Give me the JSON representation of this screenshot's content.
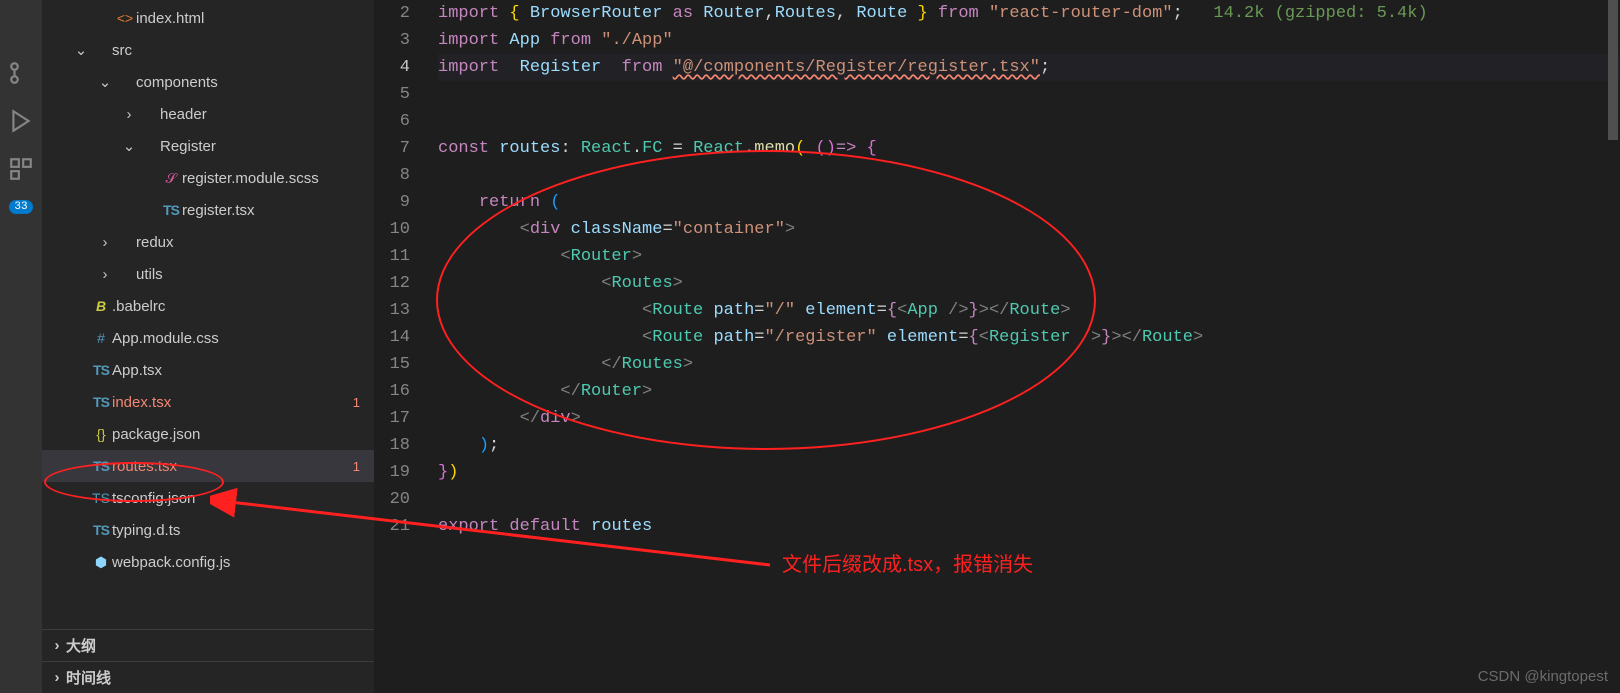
{
  "activity": {
    "badge": "33"
  },
  "tree": [
    {
      "indent": 2,
      "chev": "",
      "iconCls": "ic-html",
      "iconTxt": "<>",
      "label": "index.html",
      "err": false,
      "problems": ""
    },
    {
      "indent": 1,
      "chev": "⌄",
      "iconCls": "ic-folder",
      "iconTxt": "",
      "label": "src",
      "err": false,
      "problems": ""
    },
    {
      "indent": 2,
      "chev": "⌄",
      "iconCls": "ic-folder",
      "iconTxt": "",
      "label": "components",
      "err": false,
      "problems": ""
    },
    {
      "indent": 3,
      "chev": "›",
      "iconCls": "ic-folder",
      "iconTxt": "",
      "label": "header",
      "err": false,
      "problems": ""
    },
    {
      "indent": 3,
      "chev": "⌄",
      "iconCls": "ic-folder",
      "iconTxt": "",
      "label": "Register",
      "err": false,
      "problems": ""
    },
    {
      "indent": 4,
      "chev": "",
      "iconCls": "ic-scss",
      "iconTxt": "𝒮",
      "label": "register.module.scss",
      "err": false,
      "problems": ""
    },
    {
      "indent": 4,
      "chev": "",
      "iconCls": "ic-ts",
      "iconTxt": "TS",
      "label": "register.tsx",
      "err": false,
      "problems": ""
    },
    {
      "indent": 2,
      "chev": "›",
      "iconCls": "ic-folder",
      "iconTxt": "",
      "label": "redux",
      "err": false,
      "problems": ""
    },
    {
      "indent": 2,
      "chev": "›",
      "iconCls": "ic-folder",
      "iconTxt": "",
      "label": "utils",
      "err": false,
      "problems": ""
    },
    {
      "indent": 1,
      "chev": "",
      "iconCls": "ic-babel",
      "iconTxt": "B",
      "label": ".babelrc",
      "err": false,
      "problems": ""
    },
    {
      "indent": 1,
      "chev": "",
      "iconCls": "ic-css",
      "iconTxt": "#",
      "label": "App.module.css",
      "err": false,
      "problems": ""
    },
    {
      "indent": 1,
      "chev": "",
      "iconCls": "ic-ts",
      "iconTxt": "TS",
      "label": "App.tsx",
      "err": false,
      "problems": ""
    },
    {
      "indent": 1,
      "chev": "",
      "iconCls": "ic-ts",
      "iconTxt": "TS",
      "label": "index.tsx",
      "err": true,
      "problems": "1"
    },
    {
      "indent": 1,
      "chev": "",
      "iconCls": "ic-json",
      "iconTxt": "{}",
      "label": "package.json",
      "err": false,
      "problems": ""
    },
    {
      "indent": 1,
      "chev": "",
      "iconCls": "ic-ts",
      "iconTxt": "TS",
      "label": "routes.tsx",
      "err": true,
      "problems": "1",
      "selected": true
    },
    {
      "indent": 1,
      "chev": "",
      "iconCls": "ic-tsconfig",
      "iconTxt": "TS",
      "label": "tsconfig.json",
      "err": false,
      "problems": ""
    },
    {
      "indent": 1,
      "chev": "",
      "iconCls": "ic-ts",
      "iconTxt": "TS",
      "label": "typing.d.ts",
      "err": false,
      "problems": ""
    },
    {
      "indent": 1,
      "chev": "",
      "iconCls": "ic-webpack",
      "iconTxt": "⬢",
      "label": "webpack.config.js",
      "err": false,
      "problems": ""
    }
  ],
  "outline": [
    {
      "label": "大纲",
      "chev": "›"
    },
    {
      "label": "时间线",
      "chev": "›"
    }
  ],
  "gutter": {
    "start": 2,
    "end": 21,
    "active": 4
  },
  "hint": "14.2k (gzipped: 5.4k)",
  "code": {
    "l2": {
      "imp": "import",
      "br": "{ ",
      "BrowserRouter": "BrowserRouter",
      "as": " as ",
      "Router": "Router",
      "c": ",",
      "Routes": "Routes",
      "c2": ", ",
      "Route": "Route",
      "brc": " }",
      "from": " from ",
      "str": "\"react-router-dom\"",
      "sc": ";"
    },
    "l3": {
      "imp": "import ",
      "App": "App",
      "from": " from ",
      "str": "\"./App\""
    },
    "l4": {
      "imp": "import  ",
      "Register": "Register",
      "from": "  from ",
      "str": "\"@/components/Register/register.tsx\"",
      "sc": ";"
    },
    "l7": {
      "const": "const ",
      "routes": "routes",
      "col": ": ",
      "React": "React",
      ".": ".",
      "FC": "FC",
      "eq": " = ",
      "React2": "React",
      ".2": ".",
      "memo": "memo",
      "p": "( ",
      "arrow": "()",
      "fat": "=> ",
      "brace": "{"
    },
    "l9": {
      "return": "return ",
      "p": "("
    },
    "l10": {
      "o": "<",
      "div": "div",
      " ": " ",
      "className": "className",
      "eq": "=",
      "str": "\"container\"",
      "c": ">"
    },
    "l11": {
      "o": "<",
      "Router": "Router",
      "c": ">"
    },
    "l12": {
      "o": "<",
      "Routes": "Routes",
      "c": ">"
    },
    "l13": {
      "o": "<",
      "Route": "Route",
      " ": " ",
      "path": "path",
      "eq": "=",
      "str": "\"/\"",
      " 2": " ",
      "element": "element",
      "eq2": "=",
      "b": "{",
      "o2": "<",
      "App": "App",
      "sl": " /",
      "c2": ">",
      "b2": "}",
      "c3": ">",
      "co": "</",
      "Route2": "Route",
      "c4": ">"
    },
    "l14": {
      "o": "<",
      "Route": "Route",
      " ": " ",
      "path": "path",
      "eq": "=",
      "str": "\"/register\"",
      " 2": " ",
      "element": "element",
      "eq2": "=",
      "b": "{",
      "o2": "<",
      "Register": "Register",
      "sl": " /",
      "c2": ">",
      "b2": "}",
      "c3": ">",
      "co": "</",
      "Route2": "Route",
      "c4": ">"
    },
    "l15": {
      "co": "</",
      "Routes": "Routes",
      "c": ">"
    },
    "l16": {
      "co": "</",
      "Router": "Router",
      "c": ">"
    },
    "l17": {
      "co": "</",
      "div": "div",
      "c": ">"
    },
    "l18": {
      "p": ")",
      "sc": ";"
    },
    "l19": {
      "b": "}",
      "p": ")"
    },
    "l21": {
      "export": "export ",
      "default": "default ",
      "routes": "routes"
    }
  },
  "annotation_text": "文件后缀改成.tsx，报错消失",
  "watermark": "CSDN @kingtopest"
}
